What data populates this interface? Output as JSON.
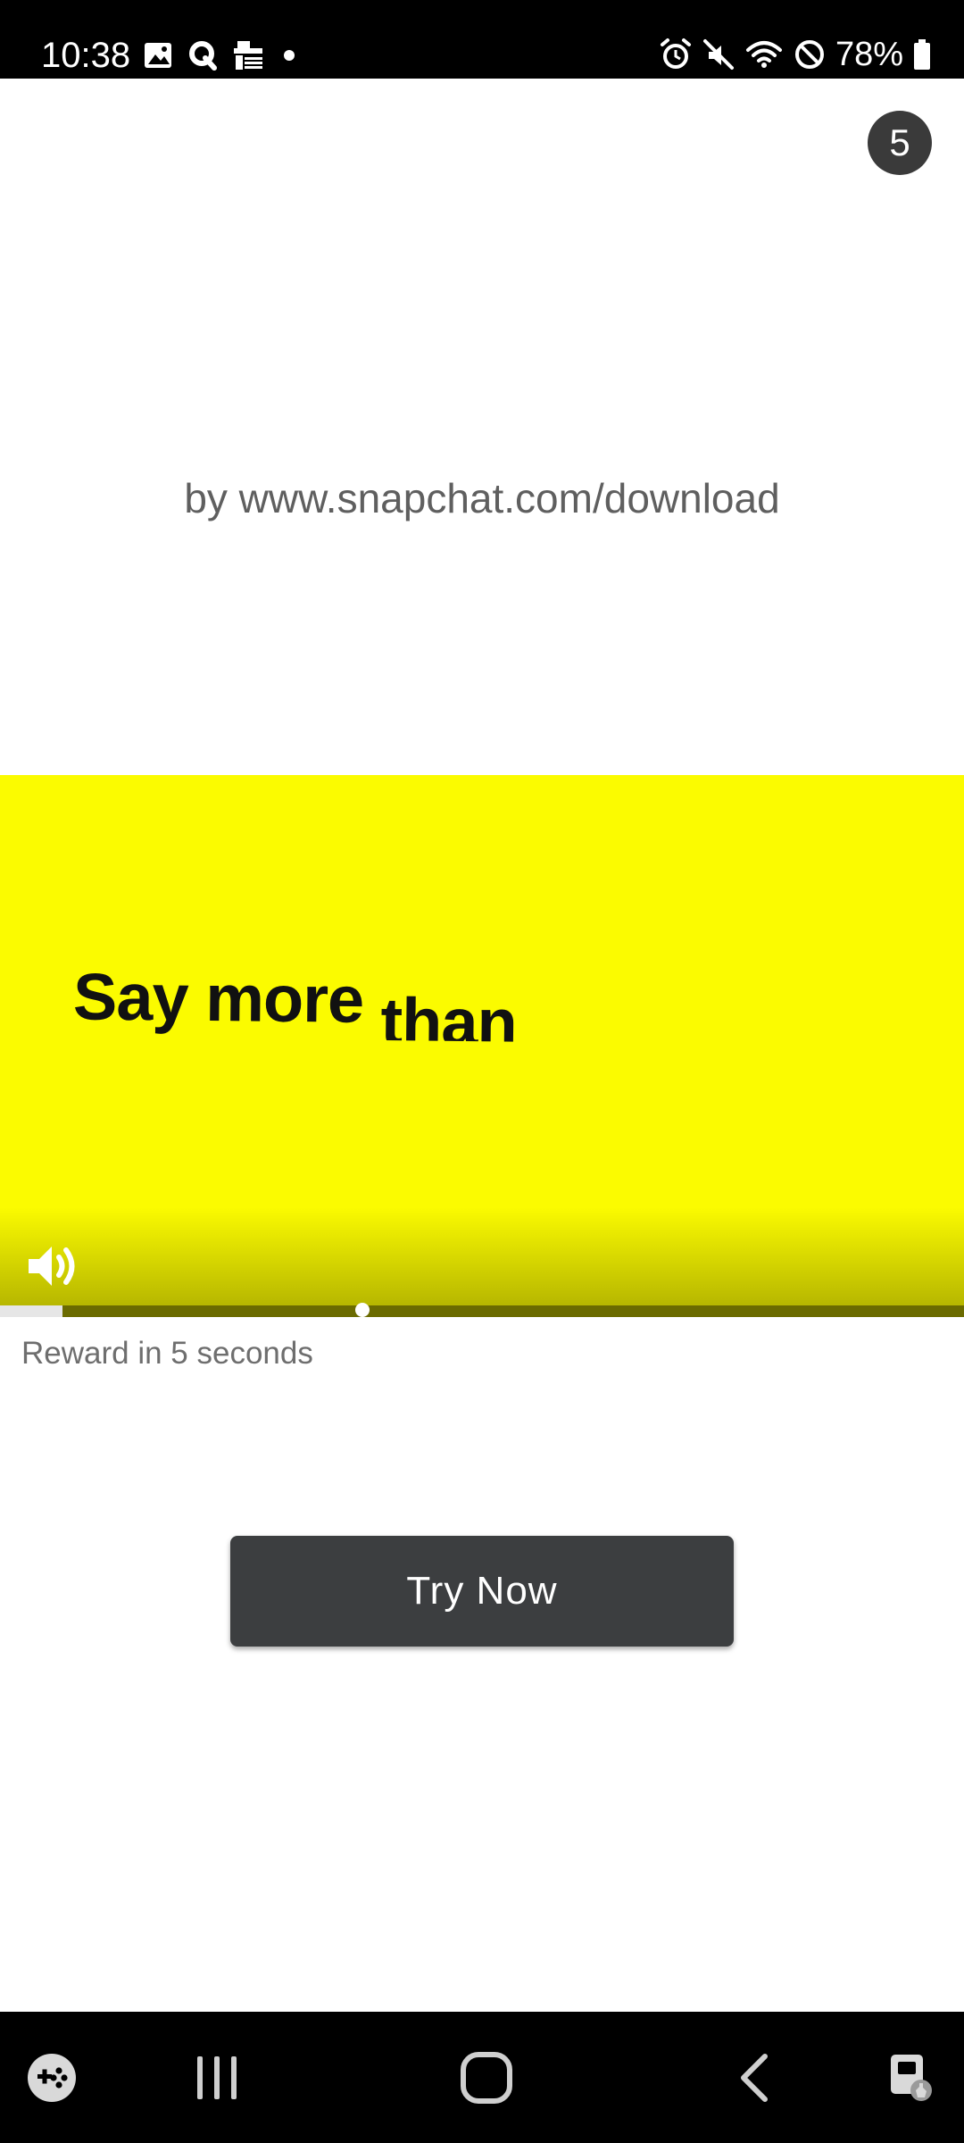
{
  "status_bar": {
    "time": "10:38",
    "battery_percent": "78%",
    "left_icons": [
      "gallery-icon",
      "q-app-icon",
      "toll-app-icon",
      "notification-dot-icon"
    ],
    "right_icons": [
      "alarm-icon",
      "mute-icon",
      "wifi-icon",
      "do-not-disturb-icon",
      "battery-icon"
    ]
  },
  "ad": {
    "countdown": "5",
    "advertiser": "by www.snapchat.com/download",
    "video_caption_main": "Say more ",
    "video_caption_tail": "than",
    "video_background_color": "#fbfb00",
    "sound_icon": "speaker-on-icon",
    "progress_fraction": 0.065,
    "reward_text": "Reward in 5 seconds",
    "cta_label": "Try Now"
  },
  "nav_bar": {
    "items": [
      "game-launcher-icon",
      "recent-apps-icon",
      "home-icon",
      "back-icon",
      "screen-pin-icon"
    ]
  }
}
